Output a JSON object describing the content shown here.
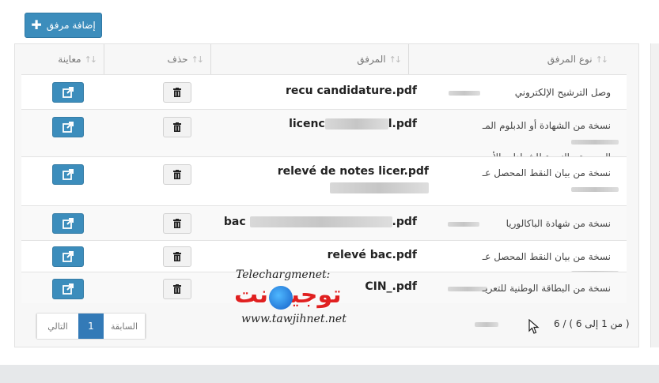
{
  "toolbar": {
    "add_label": "إضافة مرفق",
    "add_icon": "plus-icon"
  },
  "table": {
    "headers": {
      "view": "معاينة",
      "delete": "حذف",
      "file": "المرفق",
      "type": "نوع المرفق"
    },
    "rows": [
      {
        "type": "وصل الترشيح الإلكتروني",
        "file": "recu candidature.pdf"
      },
      {
        "type": "نسخة من الشهادة أو الدبلوم المـ",
        "type2": "الرسمية، بالنسبة للشهادات الأجـ",
        "file": "licenc",
        "file_end": "l.pdf"
      },
      {
        "type": "نسخة من بيان النقط المحصل عـ",
        "file": "relevé de notes licer.pdf"
      },
      {
        "type": "نسخة من شهادة الباكالوريا",
        "file": "bac",
        "file_end": ".pdf"
      },
      {
        "type": "نسخة من بيان النقط المحصل عـ",
        "file": "relevé bac.pdf"
      },
      {
        "type": "نسخة من البطاقة الوطنية للتعريـ",
        "file": "CIN_.pdf"
      }
    ]
  },
  "pagination": {
    "prev": "السابقة",
    "current": "1",
    "next": "التالي",
    "info": "( من 1 إلى 6 ) / 6"
  },
  "watermark": {
    "title": "Telechargmenet:",
    "arabic": "توجيه نت",
    "url": "www.tawjihnet.net"
  },
  "colors": {
    "primary": "#3c8dbc",
    "watermark_red": "#e02020"
  }
}
